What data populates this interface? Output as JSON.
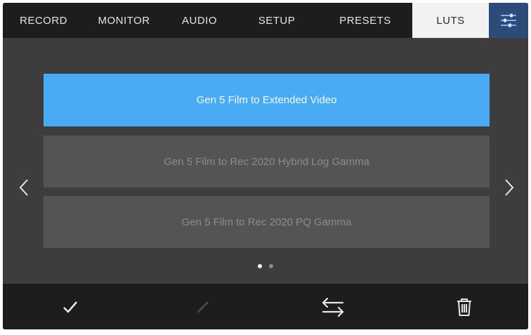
{
  "tabs": [
    {
      "label": "RECORD"
    },
    {
      "label": "MONITOR"
    },
    {
      "label": "AUDIO"
    },
    {
      "label": "SETUP"
    },
    {
      "label": "PRESETS"
    },
    {
      "label": "LUTS",
      "active": true
    }
  ],
  "settings_icon": "sliders-icon",
  "luts": [
    {
      "label": "Gen 5 Film to Extended Video",
      "selected": true
    },
    {
      "label": "Gen 5 Film to Rec 2020 Hybrid Log Gamma",
      "selected": false
    },
    {
      "label": "Gen 5 Film to Rec 2020 PQ Gamma",
      "selected": false
    }
  ],
  "pagination": {
    "current": 1,
    "total": 2
  },
  "toolbar": {
    "icons": [
      "check-icon",
      "pencil-icon",
      "swap-arrows-icon",
      "trash-icon"
    ]
  },
  "colors": {
    "selected": "#4aabf5",
    "settings_tab": "#2d4b78",
    "bar_background": "#1d1d1d",
    "screen_background": "#3d3d3d"
  }
}
